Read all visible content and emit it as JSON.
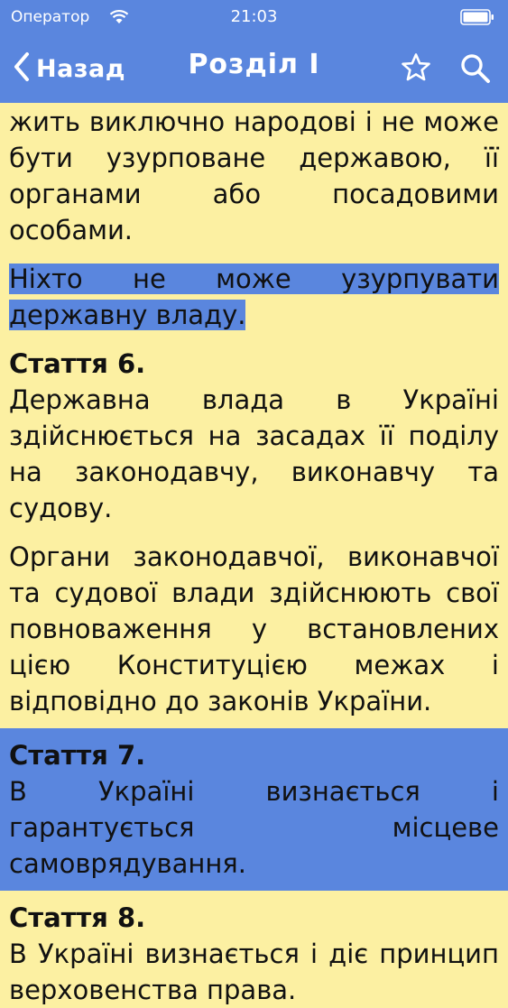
{
  "status_bar": {
    "carrier": "Оператор",
    "time": "21:03",
    "icons": [
      "wifi-icon",
      "battery-icon"
    ]
  },
  "nav": {
    "back_label": "Назад",
    "title": "Розділ I",
    "icons": [
      "chevron-left-icon",
      "star-icon",
      "search-icon"
    ]
  },
  "content": {
    "para_continuation": "жить виключно народові і не може бути узурповане державою, її органами або посадовими особами.",
    "para_highlighted": "Ніхто не може узурпувати державну владу.",
    "article6": {
      "title": "Стаття 6.",
      "p1": "Державна влада в Україні здійснюється на засадах її поділу на законодавчу, виконавчу та судову.",
      "p2": "Органи законодавчої, виконавчої та судової влади здійснюють свої повноваження у встановлених цією Конституцією межах і відповідно до законів України."
    },
    "article7": {
      "title": "Стаття 7.",
      "p1": "В Україні визнається і гарантується місцеве самоврядування."
    },
    "article8": {
      "title": "Стаття 8.",
      "p1": "В Україні визнається і діє принцип верховенства права."
    }
  },
  "colors": {
    "accent": "#5a86de",
    "background": "#fcf0a2",
    "text": "#111111"
  }
}
